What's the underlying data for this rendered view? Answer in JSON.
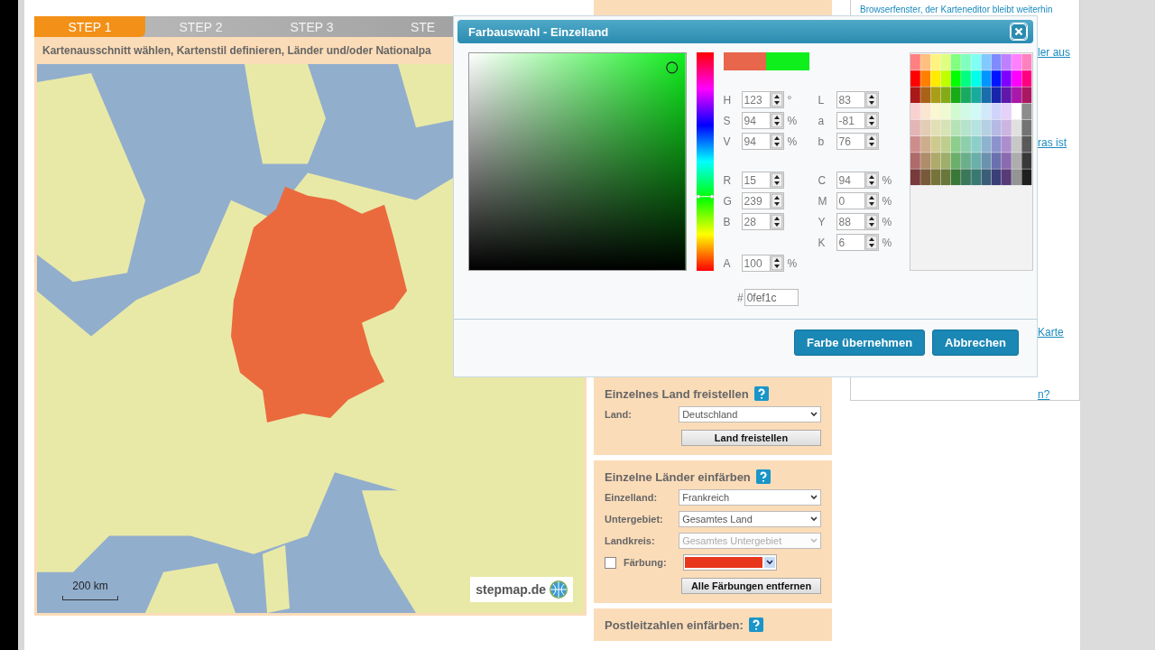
{
  "steps": [
    {
      "label": "STEP 1",
      "selected": true
    },
    {
      "label": "STEP 2",
      "selected": false
    },
    {
      "label": "STEP 3",
      "selected": false
    },
    {
      "label": "STE",
      "selected": false
    }
  ],
  "subtitle": "Kartenausschnitt wählen, Kartenstil definieren, Länder und/oder Nationalpa",
  "map": {
    "scale": "200 km",
    "logo": "stepmap.de"
  },
  "sidebar": {
    "panels": [
      {
        "title": "Einzelnes Land freistellen",
        "rows": [
          {
            "kind": "select",
            "label": "Land:",
            "value": "Deutschland",
            "disabled": false
          }
        ],
        "button": "Land freistellen"
      },
      {
        "title": "Einzelne Länder einfärben",
        "rows": [
          {
            "kind": "select",
            "label": "Einzelland:",
            "value": "Frankreich",
            "disabled": false
          },
          {
            "kind": "select",
            "label": "Untergebiet:",
            "value": "Gesamtes Land",
            "disabled": false
          },
          {
            "kind": "select",
            "label": "Landkreis:",
            "value": "Gesamtes Untergebiet",
            "disabled": true
          },
          {
            "kind": "color",
            "label": "Färbung:",
            "checked": false,
            "color": "#e8361c"
          }
        ],
        "button": "Alle Färbungen entfernen"
      },
      {
        "title": "Postleitzahlen einfärben:"
      }
    ]
  },
  "help_links": [
    "Browserfenster, der Karteneditor bleibt weiterhin",
    "ler aus",
    "ras ist",
    "Karte",
    "n?"
  ],
  "dialog": {
    "title": "Farbauswahl - Einzelland",
    "fields_left": [
      [
        {
          "label": "H",
          "value": "123",
          "unit": "°"
        },
        {
          "label": "S",
          "value": "94",
          "unit": "%"
        },
        {
          "label": "V",
          "value": "94",
          "unit": "%"
        }
      ],
      [
        {
          "label": "R",
          "value": "15"
        },
        {
          "label": "G",
          "value": "239"
        },
        {
          "label": "B",
          "value": "28"
        }
      ],
      [
        {
          "label": "A",
          "value": "100",
          "unit": "%"
        }
      ]
    ],
    "fields_right": [
      [
        {
          "label": "L",
          "value": "83"
        },
        {
          "label": "a",
          "value": "-81"
        },
        {
          "label": "b",
          "value": "76"
        }
      ],
      [
        {
          "label": "C",
          "value": "94",
          "unit": "%"
        },
        {
          "label": "M",
          "value": "0",
          "unit": "%"
        },
        {
          "label": "Y",
          "value": "88",
          "unit": "%"
        },
        {
          "label": "K",
          "value": "6",
          "unit": "%"
        }
      ]
    ],
    "hue_slider": {
      "level": 0.34
    },
    "hex_label": "#",
    "hex_value": "0fef1c",
    "buttons": [
      "Farbe übernehmen",
      "Abbrechen"
    ]
  }
}
